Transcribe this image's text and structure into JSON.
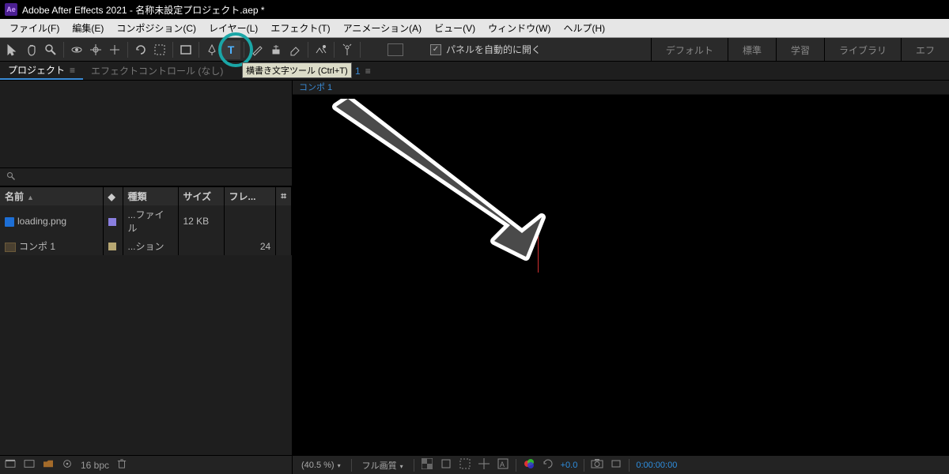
{
  "titlebar": {
    "app": "Adobe After Effects 2021",
    "project": "名称未設定プロジェクト.aep *",
    "logo_text": "Ae"
  },
  "menu": {
    "items": [
      "ファイル(F)",
      "編集(E)",
      "コンポジション(C)",
      "レイヤー(L)",
      "エフェクト(T)",
      "アニメーション(A)",
      "ビュー(V)",
      "ウィンドウ(W)",
      "ヘルプ(H)"
    ]
  },
  "toolbar": {
    "tooltip": "横書き文字ツール (Ctrl+T)",
    "snapping_label": "パネルを自動的に開く",
    "checkbox_checked": true,
    "text_tool_glyph": "T"
  },
  "workspace_tabs": [
    "デフォルト",
    "標準",
    "学習",
    "ライブラリ",
    "エフ"
  ],
  "panel_tabs": {
    "project": "プロジェクト",
    "effect_controls": "エフェクトコントロール (なし)",
    "comp_link": "ョン コンポ 1"
  },
  "project_panel": {
    "search_placeholder": "",
    "columns": {
      "name": "名前",
      "tag": "◆",
      "type": "種類",
      "size": "サイズ",
      "fr": "フレ..."
    },
    "rows": [
      {
        "icon": "file",
        "name": "loading.png",
        "swatch": "#8a7fe0",
        "type": "...ファイル",
        "size": "12 KB",
        "fr": ""
      },
      {
        "icon": "comp",
        "name": "コンポ 1",
        "swatch": "#b7a772",
        "type": "...ション",
        "size": "",
        "fr": "24"
      }
    ],
    "org_icon": "⌗"
  },
  "viewer": {
    "tab": "コンポ 1"
  },
  "bottombar": {
    "bpc": "16 bpc"
  },
  "viewfoot": {
    "zoom": "(40.5 %)",
    "res": "フル画質",
    "exposure": "+0.0",
    "time": "0:00:00:00"
  }
}
